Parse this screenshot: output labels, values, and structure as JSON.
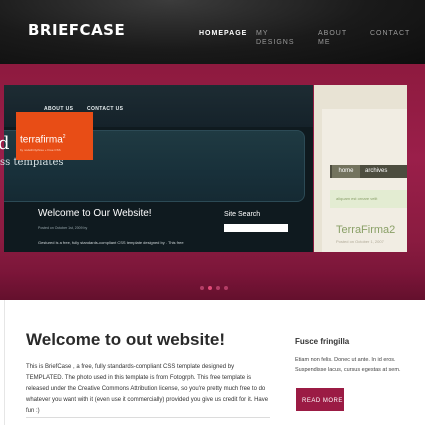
{
  "header": {
    "logo": "BRIEFCASE",
    "nav": [
      {
        "label": "HOMEPAGE",
        "active": true
      },
      {
        "label": "MY DESIGNS",
        "active": false
      },
      {
        "label": "ABOUT ME",
        "active": false
      },
      {
        "label": "CONTACT",
        "active": false
      }
    ]
  },
  "slider": {
    "slide1": {
      "nav": [
        "ABOUT US",
        "CONTACT US"
      ],
      "big_letter": "d",
      "subtitle": "ss templates",
      "welcome": "Welcome to Our Website!",
      "posted": "Posted on October 1st, 2009 by",
      "body": "Gestured is a free, fully standards-compliant CSS template designed by . This free",
      "search_label": "Site Search",
      "search_value": ""
    },
    "slide2": {
      "brand": "terrafirma",
      "brand_sup": "2",
      "tagline": "by nodethirtythree + Free CSS",
      "menu": [
        "home",
        "archives"
      ],
      "quote": "aliquam est ornare velit",
      "title": "TerraFirma2",
      "posted": "Posted on October 1, 2007"
    },
    "pager": {
      "count": 4,
      "active_index": 1
    }
  },
  "content": {
    "title": "Welcome to out website!",
    "body": "This is BriefCase , a free, fully standards-compliant CSS template designed by TEMPLATED. The photo used in this template is from Fotogrph. This free template is released under the Creative Commons Attribution license, so you're pretty much free to do whatever you want with it (even use it commercially) provided you give us credit for it. Have fun :)",
    "sidebar": {
      "title": "Fusce fringilla",
      "body": "Etiam non felis. Donec ut ante. In id eros. Suspendisse lacus, cursus egestas at sem.",
      "button": "READ MORE"
    }
  },
  "colors": {
    "accent": "#9b1b44",
    "band": "#8e1a3f",
    "header_bg": "#141414"
  }
}
